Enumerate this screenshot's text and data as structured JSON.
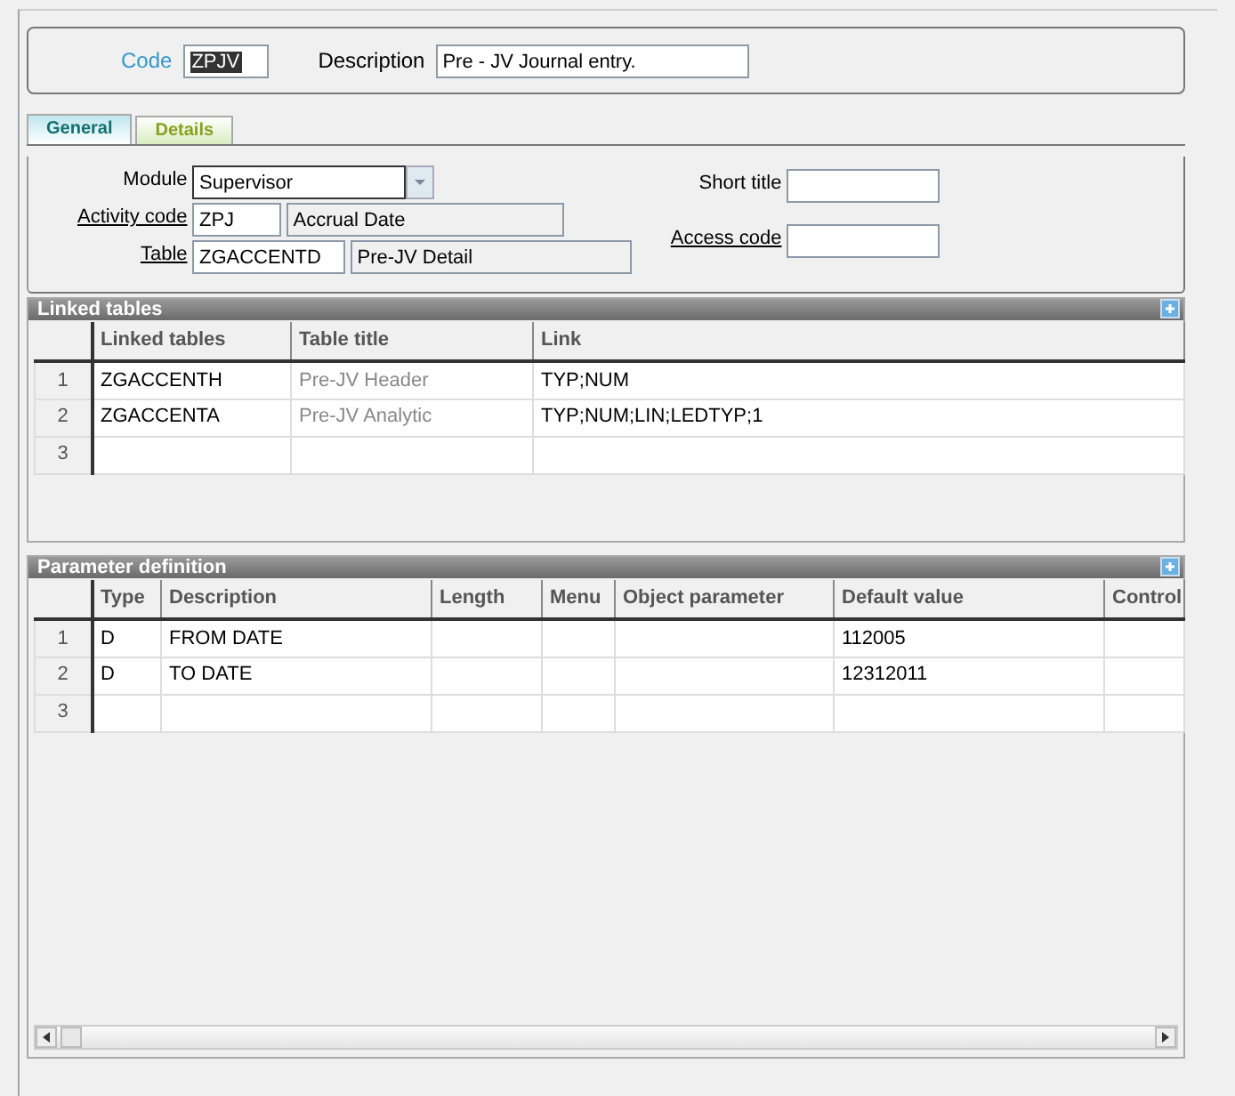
{
  "header": {
    "code": {
      "label": "Code",
      "value": "ZPJV"
    },
    "description": {
      "label": "Description",
      "value": "Pre - JV Journal entry."
    }
  },
  "tabs": [
    {
      "label": "General",
      "selected": true
    },
    {
      "label": "Details",
      "selected": false
    }
  ],
  "form": {
    "module": {
      "label": "Module",
      "value": "Supervisor"
    },
    "activity_code": {
      "label": "Activity code",
      "value": "ZPJ",
      "description": "Accrual Date"
    },
    "table": {
      "label": "Table",
      "value": "ZGACCENTD",
      "description": "Pre-JV Detail"
    },
    "short_title": {
      "label": "Short title"
    },
    "access_code": {
      "label": "Access code"
    }
  },
  "linked_tables": {
    "title": "Linked tables",
    "columns": [
      {
        "label": "Linked tables",
        "muted": false
      },
      {
        "label": "Table title",
        "muted": true
      },
      {
        "label": "Link",
        "muted": false
      }
    ],
    "rows": [
      {
        "number": "1",
        "cells": [
          "ZGACCENTH",
          "Pre-JV Header",
          "TYP;NUM"
        ]
      },
      {
        "number": "2",
        "cells": [
          "ZGACCENTA",
          "Pre-JV Analytic",
          "TYP;NUM;LIN;LEDTYP;1"
        ]
      },
      {
        "number": "3"
      }
    ]
  },
  "parameters": {
    "title": "Parameter definition",
    "columns": [
      {
        "label": "Type"
      },
      {
        "label": "Description"
      },
      {
        "label": "Length"
      },
      {
        "label": "Menu"
      },
      {
        "label": "Object parameter"
      },
      {
        "label": "Default value"
      },
      {
        "label": "Control"
      }
    ],
    "rows": [
      {
        "number": "1",
        "cells": [
          "D",
          "FROM DATE",
          "",
          "",
          "",
          "112005",
          ""
        ]
      },
      {
        "number": "2",
        "cells": [
          "D",
          "TO DATE",
          "",
          "",
          "",
          "12312011",
          ""
        ]
      },
      {
        "number": "3"
      }
    ]
  }
}
